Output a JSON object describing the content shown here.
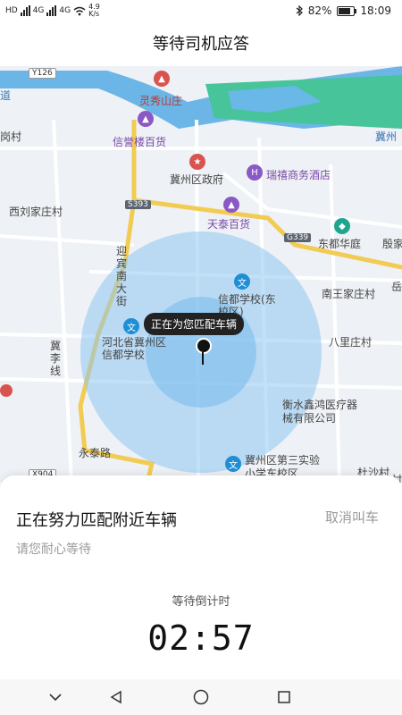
{
  "status_bar": {
    "left_labels": [
      "HD",
      "4G",
      "4G"
    ],
    "speed_value": "4.9",
    "speed_unit": "K/s",
    "battery": "82%",
    "battery_level": 0.82,
    "time": "18:09"
  },
  "header": {
    "title": "等待司机应答"
  },
  "map": {
    "labels": {
      "y126": "Y126",
      "lingxiu": "灵秀山庄",
      "xinyu": "信誉楼百货",
      "jizhou_gov": "冀州区政府",
      "ruixi": "瑞禧商务酒店",
      "xiliu": "西刘家庄村",
      "s393": "S393",
      "tiantai": "天泰百货",
      "g339": "G339",
      "dongdu": "东都华庭",
      "yingbin": "迎宾南大街",
      "xindu": "信都学校(东校区)",
      "nanwang": "南王家庄村",
      "hebei_xindu": "河北省冀州区信都学校",
      "balizhuang": "八里庄村",
      "jili": "冀李线",
      "hengshui": "衡水鑫鸿医疗器械有限公司",
      "yongtai": "永泰路",
      "x904": "X904",
      "sanshi": "冀州区第三实验小学东校区",
      "dusha": "杜沙村",
      "dao": "道",
      "ji": "冀州",
      "yue": "岳",
      "yin": "殷家",
      "gang": "岗村",
      "cun": "村"
    },
    "tooltip": "正在为您匹配车辆",
    "icons": [
      "school-icon",
      "shop-icon",
      "hotel-icon",
      "government-icon",
      "location-pin-icon"
    ]
  },
  "sheet": {
    "title": "正在努力匹配附近车辆",
    "cancel_label": "取消叫车",
    "subtitle": "请您耐心等待",
    "countdown_label": "等待倒计时",
    "countdown": "02:57"
  },
  "colors": {
    "accent": "#1e8fd6",
    "water": "#5bb0e6",
    "park": "#2fb58c",
    "road": "#f2c94c"
  }
}
